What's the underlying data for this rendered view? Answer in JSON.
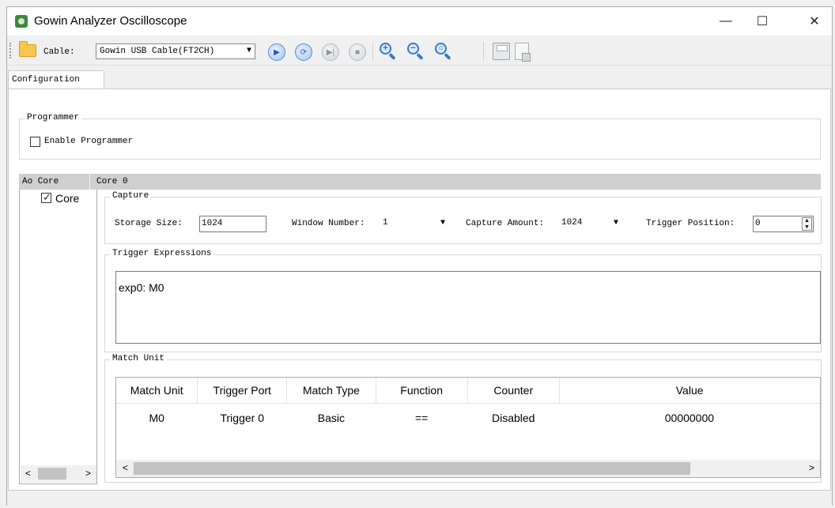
{
  "window": {
    "title": "Gowin Analyzer Oscilloscope",
    "minimize": "—",
    "maximize": "☐",
    "close": "✕"
  },
  "toolbar": {
    "cable_label": "Cable:",
    "cable_value": "Gowin USB Cable(FT2CH)",
    "dropdown_arrow": "▼",
    "icons": [
      "folder-icon",
      "play-icon",
      "repeat-icon",
      "step-icon",
      "stop-icon",
      "zoom-in-icon",
      "zoom-out-icon",
      "zoom-fit-icon",
      "save-icon",
      "export-icon"
    ]
  },
  "tabs": [
    {
      "label": "Configuration"
    }
  ],
  "programmer": {
    "group_title": "Programmer",
    "enable_label": "Enable Programmer"
  },
  "core_table": {
    "col_header": "Ao Core",
    "selected_core": "Core 0",
    "core_item": "Core"
  },
  "capture": {
    "group_title": "Capture",
    "storage_label": "Storage Size:",
    "storage_value": "1024",
    "window_label": "Window Number:",
    "window_value": "1",
    "amount_label": "Capture Amount:",
    "amount_value": "1024",
    "trigger_pos_label": "Trigger Position:",
    "trigger_pos_value": "0"
  },
  "trigger_expressions": {
    "group_title": "Trigger Expressions",
    "text": "exp0:  M0"
  },
  "match_unit": {
    "group_title": "Match Unit",
    "headers": [
      "Match Unit",
      "Trigger Port",
      "Match Type",
      "Function",
      "Counter",
      "Value"
    ],
    "rows": [
      [
        "M0",
        "Trigger 0",
        "Basic",
        "==",
        "Disabled",
        "00000000"
      ]
    ]
  },
  "scroll": {
    "left": "<",
    "right": ">"
  },
  "colors": {
    "accent": "#3a77c8",
    "header_gray": "#cfcfcf"
  }
}
